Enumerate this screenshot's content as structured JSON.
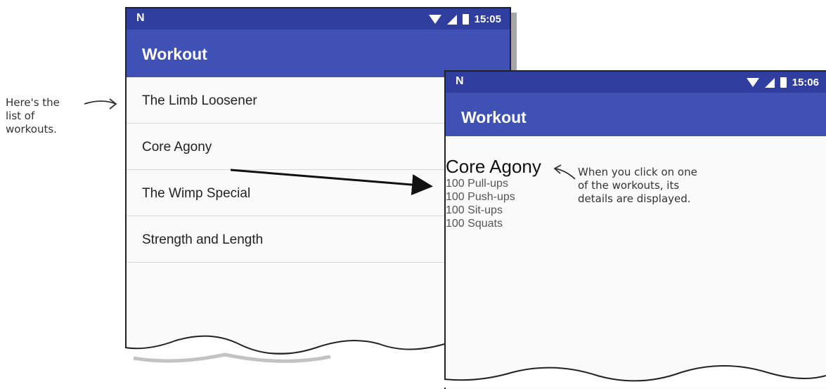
{
  "screen1": {
    "status_time": "15:05",
    "app_title": "Workout",
    "workouts": [
      {
        "label": "The Limb Loosener"
      },
      {
        "label": "Core Agony"
      },
      {
        "label": "The Wimp Special"
      },
      {
        "label": "Strength and Length"
      }
    ]
  },
  "screen2": {
    "status_time": "15:06",
    "app_title": "Workout",
    "detail_title": "Core Agony",
    "detail_lines": [
      "100 Pull-ups",
      "100 Push-ups",
      "100 Sit-ups",
      "100 Squats"
    ]
  },
  "annotations": {
    "list_note": [
      "Here's the",
      "list of",
      "workouts."
    ],
    "detail_note": [
      "When you click on one",
      "of the workouts, its",
      "details are displayed."
    ]
  },
  "colors": {
    "status_bar": "#303f9f",
    "app_bar": "#3f51b5"
  },
  "icons": {
    "status_logo": "N",
    "wifi": "wifi-icon",
    "signal": "signal-icon",
    "battery": "battery-icon"
  }
}
